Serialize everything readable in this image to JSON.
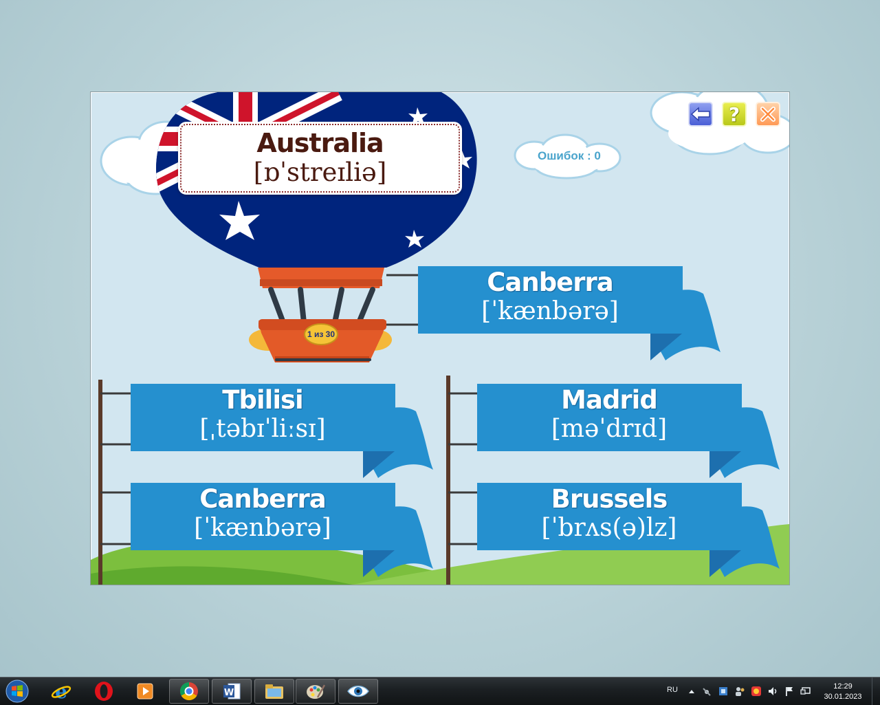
{
  "game": {
    "errors_label": "Ошибок : 0",
    "country": {
      "name": "Australia",
      "transcription": "[ɒˈstreɪliə]"
    },
    "counter": "1 из 30",
    "answers": [
      {
        "word": "Canberra",
        "transcription": "[ˈkænbərə]"
      },
      {
        "word": "Tbilisi",
        "transcription": "[ˌtəbɪˈliːsɪ]"
      },
      {
        "word": "Madrid",
        "transcription": "[məˈdrɪd]"
      },
      {
        "word": "Canberra",
        "transcription": "[ˈkænbərə]"
      },
      {
        "word": "Brussels",
        "transcription": "[ˈbrʌs(ə)lz]"
      }
    ],
    "toolbar": {
      "back_icon": "arrow-left-icon",
      "help_icon": "question-mark-icon",
      "close_icon": "close-icon"
    }
  },
  "taskbar": {
    "apps": [
      "internet-explorer-icon",
      "opera-icon",
      "media-player-icon",
      "chrome-icon",
      "word-icon",
      "explorer-icon",
      "paint-icon",
      "eye-app-icon"
    ],
    "language": "RU",
    "time": "12:29",
    "date": "30.01.2023"
  },
  "colors": {
    "ribbon": "#2590cf",
    "ribbon_dark": "#1d6fae",
    "sky": "#d2e6f0",
    "grass": "#7cc244",
    "flag_blue": "#00247d",
    "flag_red": "#cf142b"
  }
}
